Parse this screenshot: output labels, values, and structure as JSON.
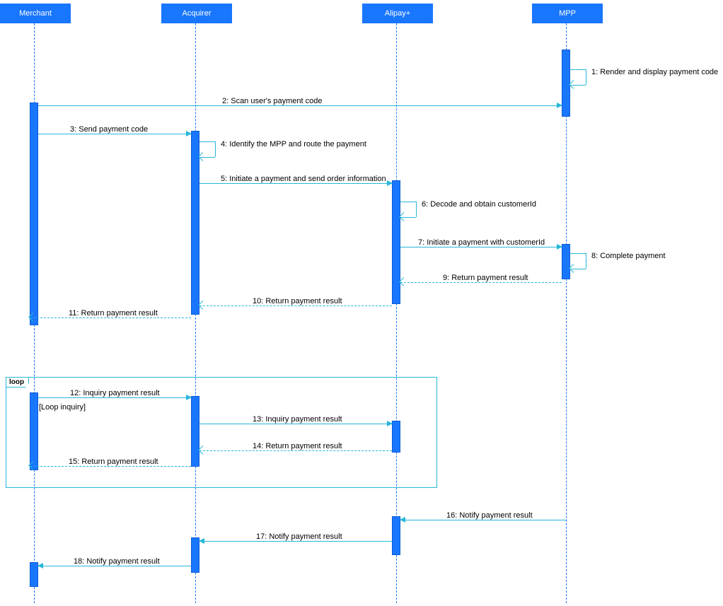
{
  "participants": {
    "merchant": "Merchant",
    "acquirer": "Acquirer",
    "alipay": "Alipay+",
    "mpp": "MPP"
  },
  "frame": {
    "label": "loop",
    "guard": "[Loop inquiry]"
  },
  "messages": {
    "m1": "1: Render and display payment code",
    "m2": "2: Scan user's payment code",
    "m3": "3: Send payment code",
    "m4": "4: Identify the MPP and route the payment",
    "m5": "5: Initiate a payment and send order information",
    "m6": "6: Decode and obtain customerId",
    "m7": "7: Initiate a payment with customerId",
    "m8": "8: Complete payment",
    "m9": "9: Return payment result",
    "m10": "10: Return payment result",
    "m11": "11: Return payment result",
    "m12": "12: Inquiry payment result",
    "m13": "13: Inquiry payment result",
    "m14": "14: Return payment result",
    "m15": "15: Return payment result",
    "m16": "16: Notify payment result",
    "m17": "17: Notify payment result",
    "m18": "18: Notify payment result"
  },
  "layout": {
    "lanes": {
      "merchant": 48,
      "acquirer": 276,
      "alipay": 560,
      "mpp": 800
    }
  }
}
